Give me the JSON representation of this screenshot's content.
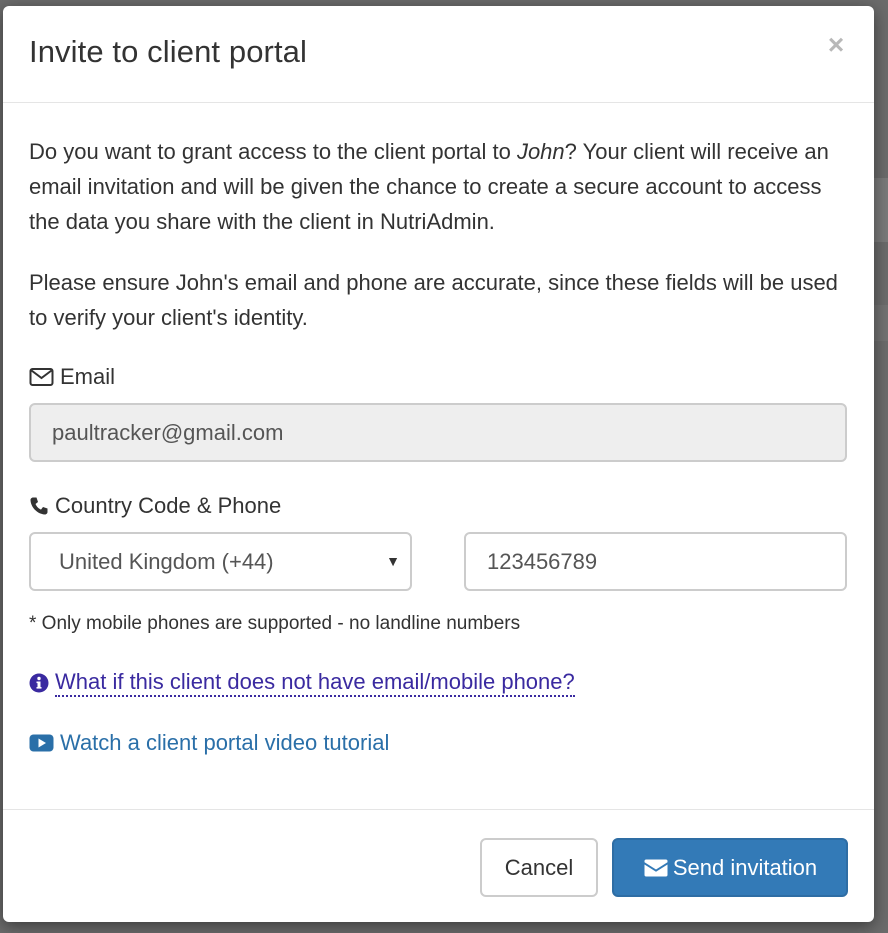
{
  "modal": {
    "title": "Invite to client portal",
    "close_label": "×"
  },
  "body": {
    "intro_before": "Do you want to grant access to the client portal to ",
    "client_name": "John",
    "intro_after": "? Your client will receive an email invitation and will be given the chance to create a secure account to access the data you share with the client in NutriAdmin.",
    "ensure_text": "Please ensure John's email and phone are accurate, since these fields will be used to verify your client's identity."
  },
  "email": {
    "label": "Email",
    "icon": "envelope-icon",
    "value": "paultracker@gmail.com"
  },
  "phone": {
    "label": "Country Code & Phone",
    "icon": "phone-icon",
    "country_selected": "United Kingdom (+44)",
    "number_value": "123456789",
    "hint": "* Only mobile phones are supported - no landline numbers"
  },
  "links": {
    "help_text": "What if this client does not have email/mobile phone?",
    "help_icon": "info-circle-icon",
    "video_text": "Watch a client portal video tutorial",
    "video_icon": "youtube-play-icon"
  },
  "footer": {
    "cancel_label": "Cancel",
    "send_label": "Send invitation",
    "send_icon": "envelope-icon"
  },
  "colors": {
    "primary": "#337ab7",
    "link_help": "#3a2aa0",
    "link_video": "#2a6fa8"
  }
}
